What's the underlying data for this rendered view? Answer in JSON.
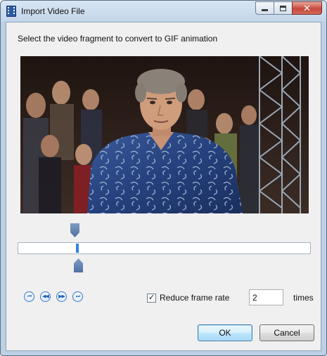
{
  "window": {
    "title": "Import Video File",
    "icon": "film-icon",
    "controls": {
      "minimize": "minimize-icon",
      "maximize": "maximize-icon",
      "close": "close-icon"
    }
  },
  "dialog": {
    "instruction": "Select the video fragment to convert to GIF animation",
    "video_preview": {
      "description_icon": "video-frame"
    },
    "timeline": {
      "start_marker_fraction": 0.19,
      "end_marker_fraction": 0.2,
      "position_fraction": 0.2
    },
    "playback": {
      "buttons": [
        {
          "icon": "skip-to-start-icon",
          "glyph": "⏮"
        },
        {
          "icon": "rewind-icon",
          "glyph": "◀◀"
        },
        {
          "icon": "fast-forward-icon",
          "glyph": "▶▶"
        },
        {
          "icon": "skip-to-end-icon",
          "glyph": "⏭"
        }
      ]
    },
    "reduce_frame_rate": {
      "checked": true,
      "label": "Reduce frame rate",
      "value": "2",
      "unit": "times"
    },
    "buttons": {
      "ok": "OK",
      "cancel": "Cancel"
    }
  },
  "colors": {
    "accent": "#2f86e0",
    "marker": "#5b7aa8",
    "title_bar": "#c2d6ea"
  }
}
